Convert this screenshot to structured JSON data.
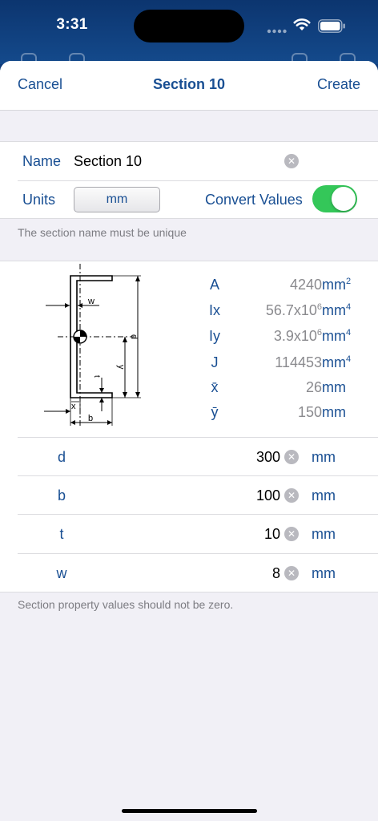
{
  "status": {
    "time": "3:31"
  },
  "nav": {
    "cancel": "Cancel",
    "title": "Section 10",
    "create": "Create"
  },
  "form": {
    "name_label": "Name",
    "name_value": "Section 10",
    "units_label": "Units",
    "units_value": "mm",
    "convert_label": "Convert Values",
    "convert_on": true,
    "name_note": "The section name must be unique"
  },
  "diagram_labels": {
    "w": "w",
    "d": "d",
    "y": "y",
    "t": "t",
    "x": "x",
    "b": "b",
    "y_bar": "ȳ",
    "x_bar": "x̄"
  },
  "properties": [
    {
      "symbol": "A",
      "value": "4240",
      "unit": "mm",
      "unit_sup": "2"
    },
    {
      "symbol": "Ix",
      "value_base": "56.7x10",
      "value_sup": "6",
      "unit": "mm",
      "unit_sup": "4"
    },
    {
      "symbol": "Iy",
      "value_base": "3.9x10",
      "value_sup": "6",
      "unit": "mm",
      "unit_sup": "4"
    },
    {
      "symbol": "J",
      "value": "114453",
      "unit": "mm",
      "unit_sup": "4"
    },
    {
      "symbol": "x̄",
      "value": "26",
      "unit": "mm"
    },
    {
      "symbol": "ȳ",
      "value": "150",
      "unit": "mm"
    }
  ],
  "dimensions": [
    {
      "symbol": "d",
      "value": "300",
      "unit": "mm"
    },
    {
      "symbol": "b",
      "value": "100",
      "unit": "mm"
    },
    {
      "symbol": "t",
      "value": "10",
      "unit": "mm"
    },
    {
      "symbol": "w",
      "value": "8",
      "unit": "mm"
    }
  ],
  "dims_note": "Section property values should not be zero.",
  "colors": {
    "accent": "#194f93",
    "toggle_on": "#34c759",
    "status_bg": "#0f3b7a",
    "sheet_bg": "#f1f0f6"
  }
}
